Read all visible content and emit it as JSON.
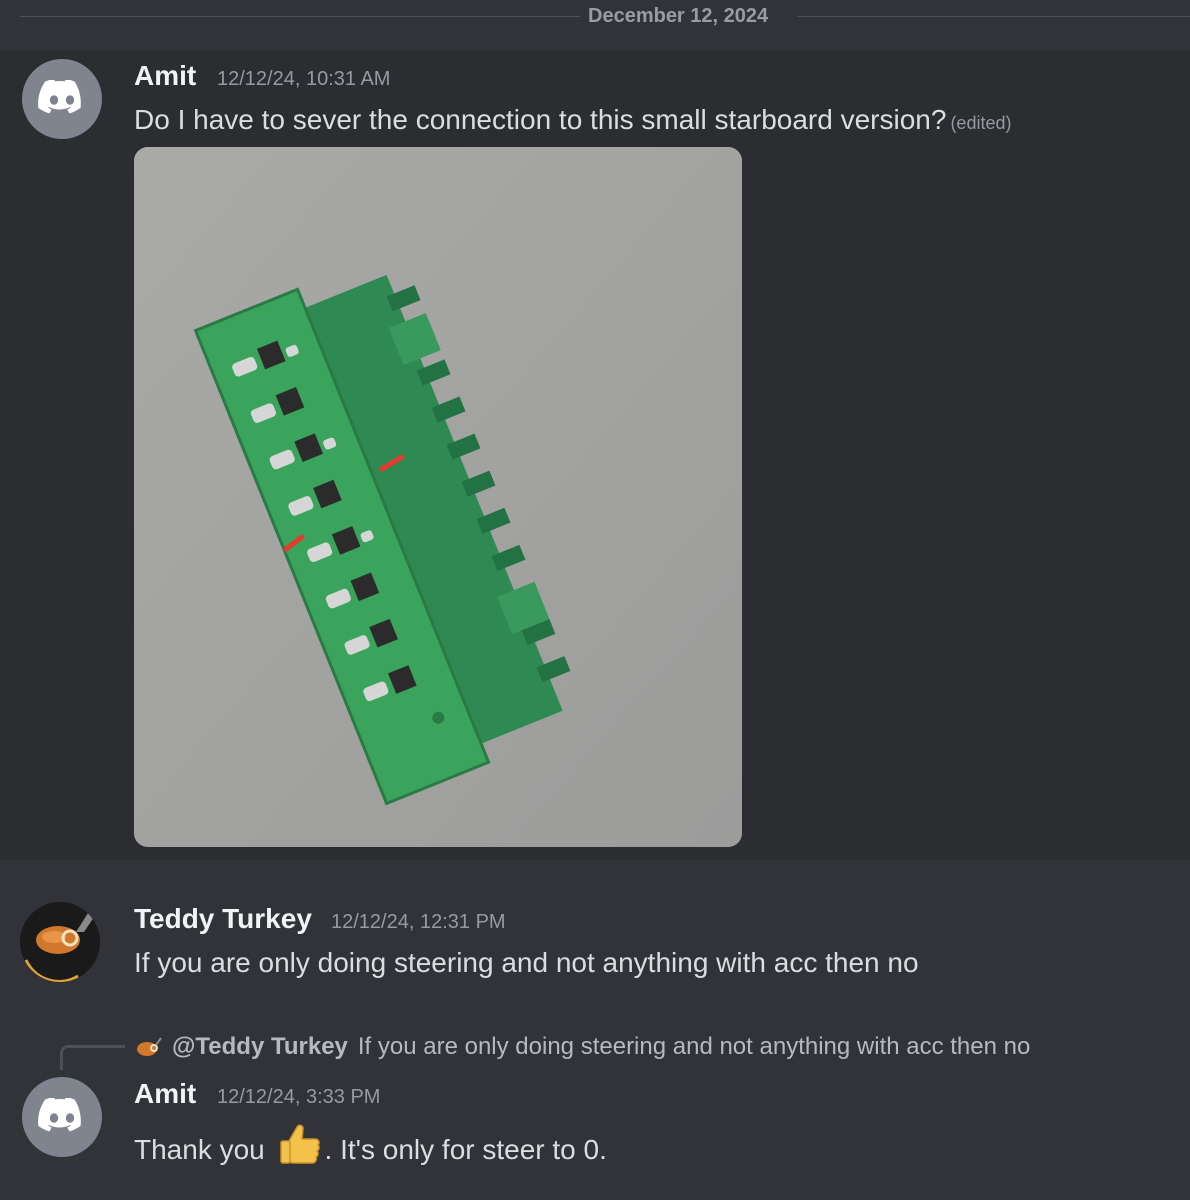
{
  "date_divider": "December 12, 2024",
  "messages": [
    {
      "author": "Amit",
      "timestamp": "12/12/24, 10:31 AM",
      "content": "Do I have to sever the connection to this small starboard version?",
      "edited_label": "(edited)",
      "avatar": "discord-logo-icon",
      "attachment": "pcb-connector-photo"
    },
    {
      "author": "Teddy Turkey",
      "timestamp": "12/12/24, 12:31 PM",
      "content": "If you are only doing steering and not anything with acc then no",
      "avatar": "turkey-avatar"
    },
    {
      "author": "Amit",
      "timestamp": "12/12/24, 3:33 PM",
      "content_before": "Thank you",
      "emoji": "thumbs-up-icon",
      "content_after": ".  It's only for steer to 0.",
      "avatar": "discord-logo-icon",
      "reply": {
        "mention": "@Teddy Turkey",
        "text": "If you are only doing steering and not anything with acc then no"
      }
    }
  ],
  "colors": {
    "background": "#313338",
    "highlight": "#2b2d31",
    "author": "#f2f3f5",
    "timestamp": "#949ba4",
    "text": "#dbdee1"
  }
}
